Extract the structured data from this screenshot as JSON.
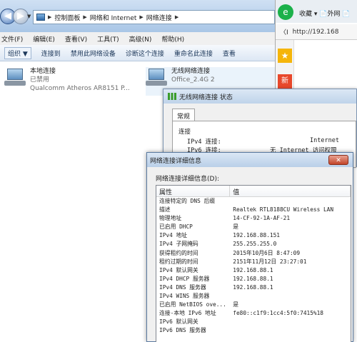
{
  "explorer": {
    "breadcrumb": [
      "控制面板",
      "网络和 Internet",
      "网络连接"
    ],
    "menu": [
      "文件(F)",
      "编辑(E)",
      "查看(V)",
      "工具(T)",
      "高级(N)",
      "帮助(H)"
    ],
    "toolbar": [
      "组织 ▼",
      "连接到",
      "禁用此网络设备",
      "诊断这个连接",
      "重命名此连接",
      "查看"
    ],
    "connections": [
      {
        "name": "本地连接",
        "status": "已禁用",
        "device": "Qualcomm Atheros AR8151 P..."
      },
      {
        "name": "无线网络连接",
        "status": "Office_2.4G  2",
        "device": ""
      }
    ]
  },
  "browser": {
    "favorites": "收藏 ▾ 📄外网 📄",
    "back": "〈I",
    "url": "http://192.168"
  },
  "status_dialog": {
    "title": "无线网络连接 状态",
    "tab": "常规",
    "section": "连接",
    "rows": [
      {
        "label": "IPv4 连接:",
        "value": "Internet"
      },
      {
        "label": "IPv6 连接:",
        "value": "无 Internet 访问权限"
      }
    ]
  },
  "details_dialog": {
    "title": "网络连接详细信息",
    "label": "网络连接详细信息(D):",
    "headers": [
      "属性",
      "值"
    ],
    "close": "✕",
    "rows": [
      [
        "连接特定的 DNS 后缀",
        ""
      ],
      [
        "描述",
        "Realtek RTL8188CU Wireless LAN"
      ],
      [
        "物理地址",
        "14-CF-92-1A-AF-21"
      ],
      [
        "已启用 DHCP",
        "是"
      ],
      [
        "IPv4 地址",
        "192.168.88.151"
      ],
      [
        "IPv4 子网掩码",
        "255.255.255.0"
      ],
      [
        "获得租约的时间",
        "2015年10月6日 8:47:09"
      ],
      [
        "租约过期的时间",
        "2151年11月12日 23:27:01"
      ],
      [
        "IPv4 默认网关",
        "192.168.88.1"
      ],
      [
        "IPv4 DHCP 服务器",
        "192.168.88.1"
      ],
      [
        "IPv4 DNS 服务器",
        "192.168.88.1"
      ],
      [
        "IPv4 WINS 服务器",
        ""
      ],
      [
        "已启用 NetBIOS ove...",
        "是"
      ],
      [
        "连接-本地 IPv6 地址",
        "fe80::c1f9:1cc4:5f0:7415%18"
      ],
      [
        "IPv6 默认网关",
        ""
      ],
      [
        "IPv6 DNS 服务器",
        ""
      ]
    ]
  }
}
